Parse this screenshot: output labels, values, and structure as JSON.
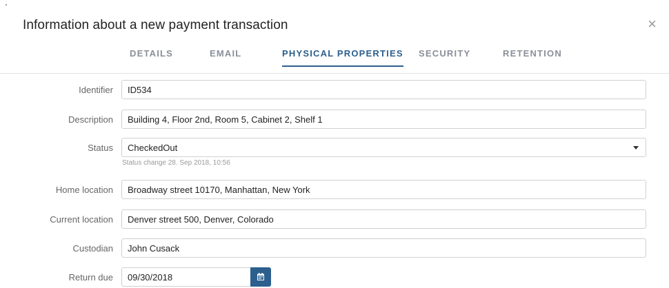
{
  "dialog": {
    "title": "Information about a new payment transaction",
    "close_symbol": "×"
  },
  "tabs": [
    {
      "label": "DETAILS",
      "active": false
    },
    {
      "label": "EMAIL",
      "active": false
    },
    {
      "label": "PHYSICAL PROPERTIES",
      "active": true
    },
    {
      "label": "SECURITY",
      "active": false
    },
    {
      "label": "RETENTION",
      "active": false
    }
  ],
  "form": {
    "identifier": {
      "label": "Identifier",
      "value": "ID534"
    },
    "description": {
      "label": "Description",
      "value": "Building 4, Floor 2nd, Room 5, Cabinet 2, Shelf 1"
    },
    "status": {
      "label": "Status",
      "value": "CheckedOut",
      "hint": "Status change 28. Sep 2018, 10:56"
    },
    "home_location": {
      "label": "Home location",
      "value": "Broadway street 10170, Manhattan, New York"
    },
    "current_location": {
      "label": "Current location",
      "value": "Denver street 500, Denver, Colorado"
    },
    "custodian": {
      "label": "Custodian",
      "value": "John Cusack"
    },
    "return_due": {
      "label": "Return due",
      "value": "09/30/2018"
    }
  },
  "icons": {
    "close": "close-icon",
    "dropdown": "chevron-down-icon",
    "calendar": "calendar-icon"
  },
  "colors": {
    "accent": "#2c5f8d",
    "tab_inactive": "#8a8f99",
    "label": "#666666",
    "border": "#d0d0d0"
  }
}
